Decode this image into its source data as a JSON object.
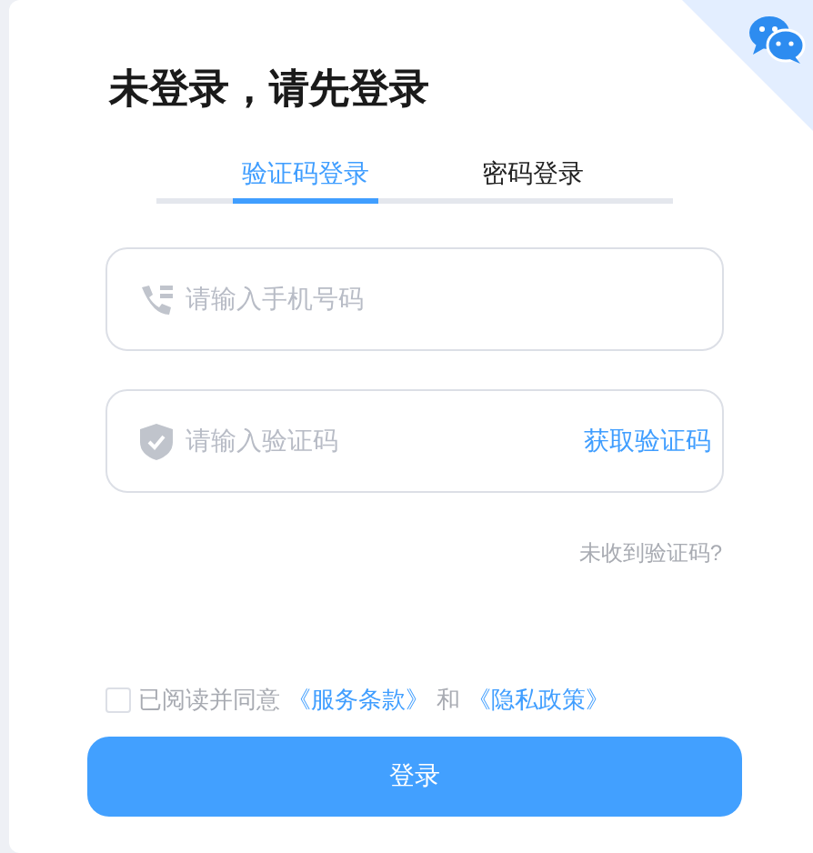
{
  "title": "未登录，请先登录",
  "tabs": [
    {
      "label": "验证码登录",
      "selected": true
    },
    {
      "label": "密码登录",
      "selected": false
    }
  ],
  "phone_field": {
    "placeholder": "请输入手机号码"
  },
  "code_field": {
    "placeholder": "请输入验证码",
    "action": "获取验证码"
  },
  "no_code_link": "未收到验证码?",
  "agreement": {
    "checked": false,
    "text": "已阅读并同意",
    "terms": "《服务条款》",
    "and": "和",
    "privacy": "《隐私政策》"
  },
  "login_button": "登录"
}
